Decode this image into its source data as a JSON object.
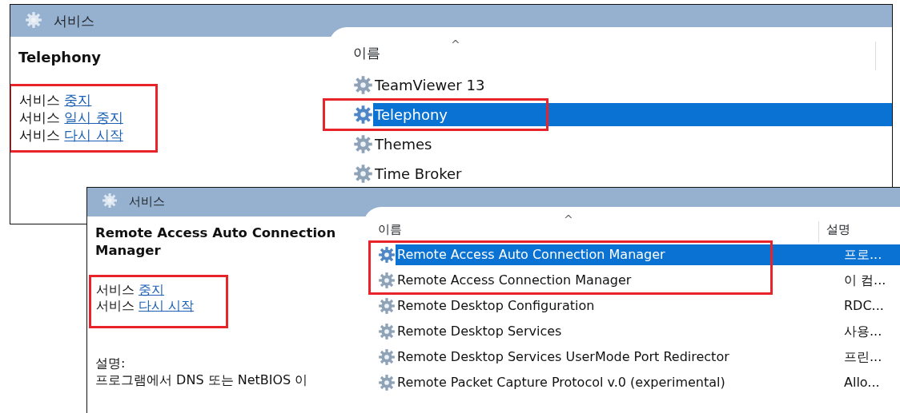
{
  "windows": [
    {
      "title": "서비스",
      "service_name": "Telephony",
      "actions_highlighted": true,
      "actions": [
        {
          "prefix": "서비스",
          "link": "중지"
        },
        {
          "prefix": "서비스",
          "link": "일시 중지"
        },
        {
          "prefix": "서비스",
          "link": "다시 시작"
        }
      ],
      "columns": [
        {
          "label": "이름",
          "sort_mark": "^"
        }
      ],
      "rows": [
        {
          "name": "TeamViewer 13",
          "selected": false,
          "highlighted": false
        },
        {
          "name": "Telephony",
          "selected": true,
          "highlighted": true
        },
        {
          "name": "Themes",
          "selected": false,
          "highlighted": false
        },
        {
          "name": "Time Broker",
          "selected": false,
          "highlighted": false
        }
      ]
    },
    {
      "title": "서비스",
      "service_name": "Remote Access Auto Connection Manager",
      "actions_highlighted": true,
      "actions": [
        {
          "prefix": "서비스",
          "link": "중지"
        },
        {
          "prefix": "서비스",
          "link": "다시 시작"
        }
      ],
      "description_label": "설명:",
      "description": "프로그램에서 DNS 또는 NetBIOS 이",
      "columns": [
        {
          "label": "이름",
          "sort_mark": "^"
        },
        {
          "label": "설명"
        }
      ],
      "rows": [
        {
          "name": "Remote Access Auto Connection Manager",
          "description": "프로...",
          "selected": true,
          "highlighted": true
        },
        {
          "name": "Remote Access Connection Manager",
          "description": "이 컴...",
          "selected": false,
          "highlighted": true
        },
        {
          "name": "Remote Desktop Configuration",
          "description": "RDC...",
          "selected": false,
          "highlighted": false
        },
        {
          "name": "Remote Desktop Services",
          "description": "사용...",
          "selected": false,
          "highlighted": false
        },
        {
          "name": "Remote Desktop Services UserMode Port Redirector",
          "description": "프린...",
          "selected": false,
          "highlighted": false
        },
        {
          "name": "Remote Packet Capture Protocol v.0 (experimental)",
          "description": "Allo...",
          "selected": false,
          "highlighted": false
        }
      ]
    }
  ]
}
